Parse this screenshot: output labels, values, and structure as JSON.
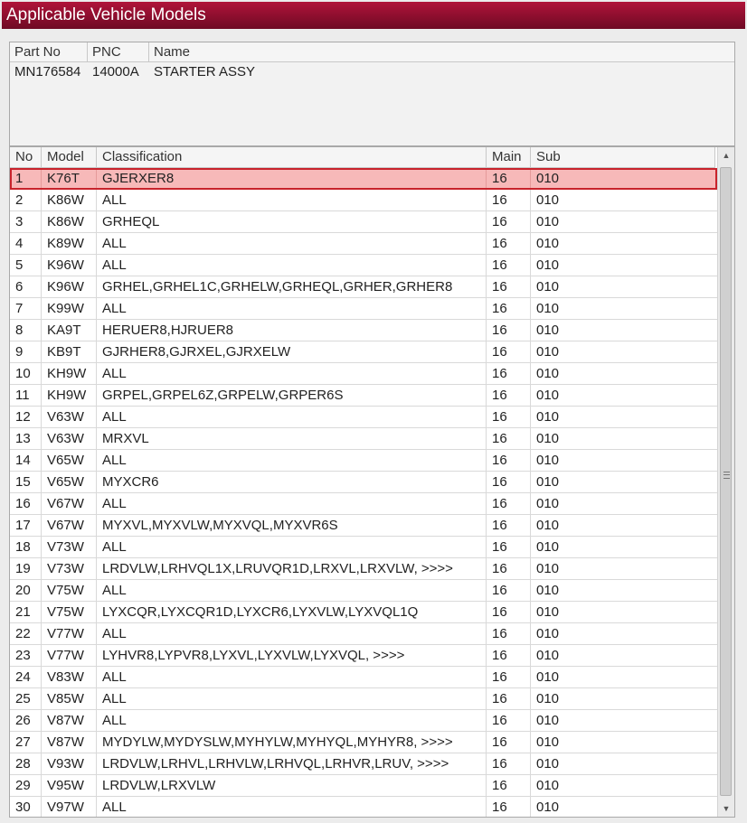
{
  "window": {
    "title": "Applicable Vehicle Models"
  },
  "part": {
    "headers": {
      "part_no": "Part No",
      "pnc": "PNC",
      "name": "Name"
    },
    "row": {
      "part_no": "MN176584",
      "pnc": "14000A",
      "name": "STARTER ASSY"
    }
  },
  "models_table": {
    "headers": {
      "no": "No",
      "model": "Model",
      "classification": "Classification",
      "main": "Main",
      "sub": "Sub"
    },
    "selected_row": 1,
    "rows": [
      {
        "no": "1",
        "model": "K76T",
        "classification": "GJERXER8",
        "main": "16",
        "sub": "010"
      },
      {
        "no": "2",
        "model": "K86W",
        "classification": "ALL",
        "main": "16",
        "sub": "010"
      },
      {
        "no": "3",
        "model": "K86W",
        "classification": "GRHEQL",
        "main": "16",
        "sub": "010"
      },
      {
        "no": "4",
        "model": "K89W",
        "classification": "ALL",
        "main": "16",
        "sub": "010"
      },
      {
        "no": "5",
        "model": "K96W",
        "classification": "ALL",
        "main": "16",
        "sub": "010"
      },
      {
        "no": "6",
        "model": "K96W",
        "classification": "GRHEL,GRHEL1C,GRHELW,GRHEQL,GRHER,GRHER8",
        "main": "16",
        "sub": "010"
      },
      {
        "no": "7",
        "model": "K99W",
        "classification": "ALL",
        "main": "16",
        "sub": "010"
      },
      {
        "no": "8",
        "model": "KA9T",
        "classification": "HERUER8,HJRUER8",
        "main": "16",
        "sub": "010"
      },
      {
        "no": "9",
        "model": "KB9T",
        "classification": "GJRHER8,GJRXEL,GJRXELW",
        "main": "16",
        "sub": "010"
      },
      {
        "no": "10",
        "model": "KH9W",
        "classification": "ALL",
        "main": "16",
        "sub": "010"
      },
      {
        "no": "11",
        "model": "KH9W",
        "classification": "GRPEL,GRPEL6Z,GRPELW,GRPER6S",
        "main": "16",
        "sub": "010"
      },
      {
        "no": "12",
        "model": "V63W",
        "classification": "ALL",
        "main": "16",
        "sub": "010"
      },
      {
        "no": "13",
        "model": "V63W",
        "classification": "MRXVL",
        "main": "16",
        "sub": "010"
      },
      {
        "no": "14",
        "model": "V65W",
        "classification": "ALL",
        "main": "16",
        "sub": "010"
      },
      {
        "no": "15",
        "model": "V65W",
        "classification": "MYXCR6",
        "main": "16",
        "sub": "010"
      },
      {
        "no": "16",
        "model": "V67W",
        "classification": "ALL",
        "main": "16",
        "sub": "010"
      },
      {
        "no": "17",
        "model": "V67W",
        "classification": "MYXVL,MYXVLW,MYXVQL,MYXVR6S",
        "main": "16",
        "sub": "010"
      },
      {
        "no": "18",
        "model": "V73W",
        "classification": "ALL",
        "main": "16",
        "sub": "010"
      },
      {
        "no": "19",
        "model": "V73W",
        "classification": "LRDVLW,LRHVQL1X,LRUVQR1D,LRXVL,LRXVLW,  >>>>",
        "main": "16",
        "sub": "010"
      },
      {
        "no": "20",
        "model": "V75W",
        "classification": "ALL",
        "main": "16",
        "sub": "010"
      },
      {
        "no": "21",
        "model": "V75W",
        "classification": "LYXCQR,LYXCQR1D,LYXCR6,LYXVLW,LYXVQL1Q",
        "main": "16",
        "sub": "010"
      },
      {
        "no": "22",
        "model": "V77W",
        "classification": "ALL",
        "main": "16",
        "sub": "010"
      },
      {
        "no": "23",
        "model": "V77W",
        "classification": "LYHVR8,LYPVR8,LYXVL,LYXVLW,LYXVQL,  >>>>",
        "main": "16",
        "sub": "010"
      },
      {
        "no": "24",
        "model": "V83W",
        "classification": "ALL",
        "main": "16",
        "sub": "010"
      },
      {
        "no": "25",
        "model": "V85W",
        "classification": "ALL",
        "main": "16",
        "sub": "010"
      },
      {
        "no": "26",
        "model": "V87W",
        "classification": "ALL",
        "main": "16",
        "sub": "010"
      },
      {
        "no": "27",
        "model": "V87W",
        "classification": "MYDYLW,MYDYSLW,MYHYLW,MYHYQL,MYHYR8,  >>>>",
        "main": "16",
        "sub": "010"
      },
      {
        "no": "28",
        "model": "V93W",
        "classification": "LRDVLW,LRHVL,LRHVLW,LRHVQL,LRHVR,LRUV,  >>>>",
        "main": "16",
        "sub": "010"
      },
      {
        "no": "29",
        "model": "V95W",
        "classification": "LRDVLW,LRXVLW",
        "main": "16",
        "sub": "010"
      },
      {
        "no": "30",
        "model": "V97W",
        "classification": "ALL",
        "main": "16",
        "sub": "010"
      }
    ]
  },
  "colors": {
    "title_bar": "#8c0e2e",
    "selected_row_fill": "#f7b9b9",
    "selected_row_border": "#c8232c"
  },
  "icons": {
    "scroll_up": "triangle-up-icon",
    "scroll_down": "triangle-down-icon",
    "thumb_grip": "grip-icon"
  }
}
